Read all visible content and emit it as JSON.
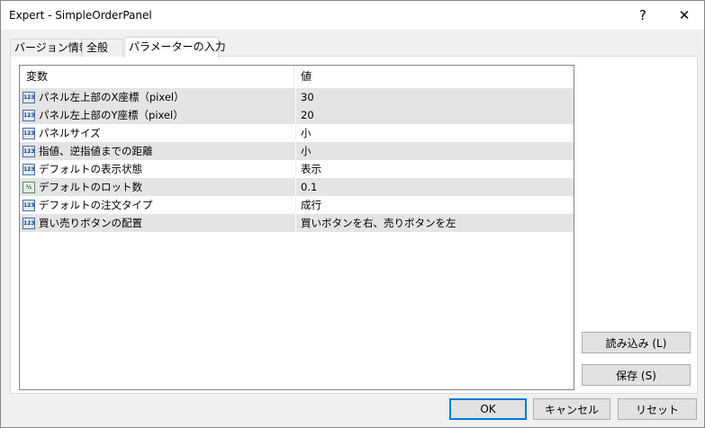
{
  "window": {
    "title": "Expert - SimpleOrderPanel",
    "help_label": "?",
    "close_label": "✕"
  },
  "tabs": [
    {
      "label": "バージョン情報"
    },
    {
      "label": "全般"
    },
    {
      "label": "パラメーターの入力",
      "active": true
    }
  ],
  "grid": {
    "columns": {
      "variable": "変数",
      "value": "値"
    },
    "rows": [
      {
        "icon": "int-type-icon",
        "icon_text": "123",
        "name": "パネル左上部のX座標（pixel）",
        "value": "30"
      },
      {
        "icon": "int-type-icon",
        "icon_text": "123",
        "name": "パネル左上部のY座標（pixel）",
        "value": "20"
      },
      {
        "icon": "int-type-icon",
        "icon_text": "123",
        "name": "パネルサイズ",
        "value": "小"
      },
      {
        "icon": "int-type-icon",
        "icon_text": "123",
        "name": "指値、逆指値までの距離",
        "value": "小"
      },
      {
        "icon": "int-type-icon",
        "icon_text": "123",
        "name": "デフォルトの表示状態",
        "value": "表示"
      },
      {
        "icon": "double-type-icon",
        "icon_text": "½",
        "name": "デフォルトのロット数",
        "value": "0.1"
      },
      {
        "icon": "int-type-icon",
        "icon_text": "123",
        "name": "デフォルトの注文タイプ",
        "value": "成行"
      },
      {
        "icon": "int-type-icon",
        "icon_text": "123",
        "name": "買い売りボタンの配置",
        "value": "買いボタンを右、売りボタンを左"
      }
    ]
  },
  "buttons": {
    "load": "読み込み (L)",
    "save": "保存 (S)",
    "ok": "OK",
    "cancel": "キャンセル",
    "reset": "リセット"
  }
}
